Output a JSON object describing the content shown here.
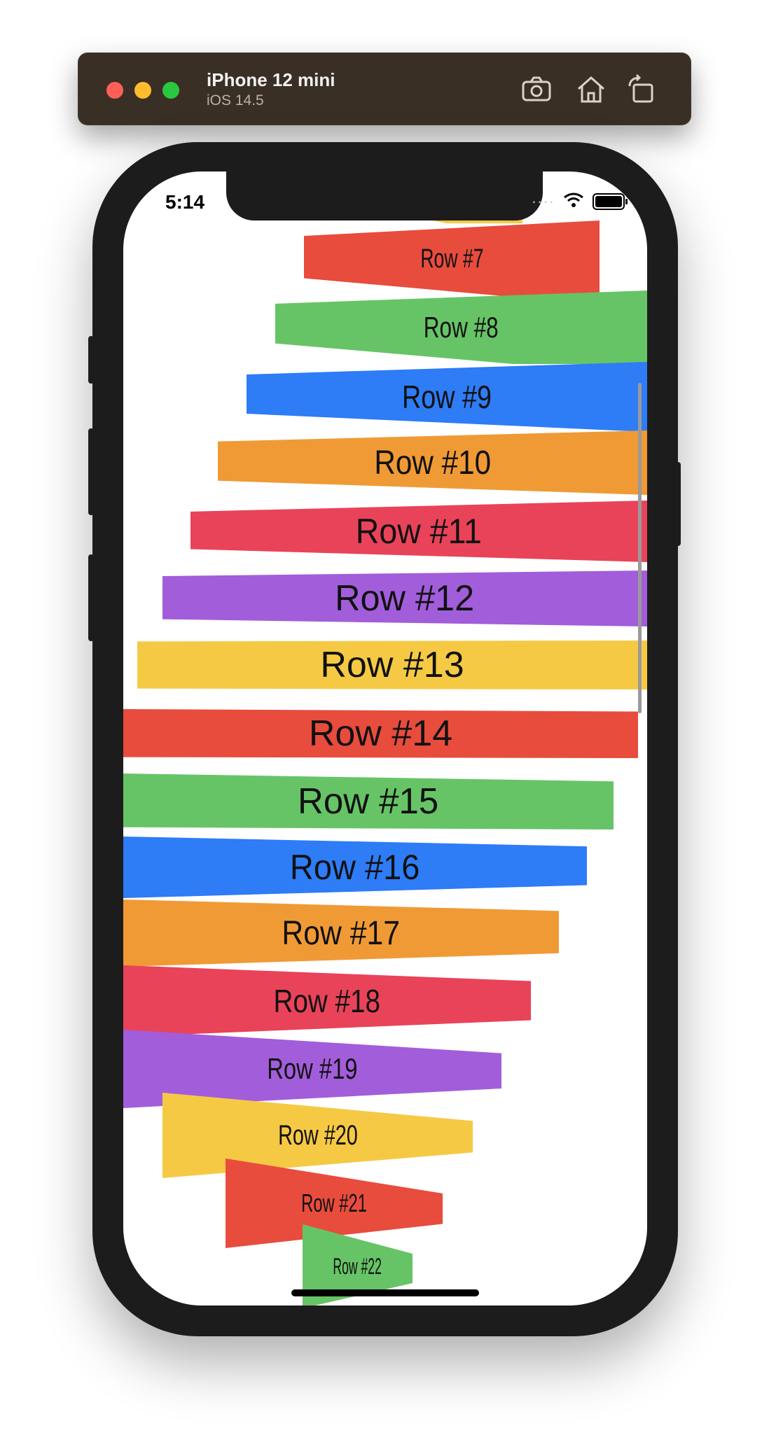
{
  "simulator": {
    "device_name": "iPhone 12 mini",
    "os_version": "iOS 14.5",
    "toolbar_icons": [
      "screenshot-icon",
      "home-icon",
      "rotate-icon"
    ]
  },
  "status_bar": {
    "time": "5:14",
    "icons": [
      "signal-icon",
      "wifi-icon",
      "battery-icon"
    ]
  },
  "rows": [
    {
      "label": "Row #7",
      "color": "#e84c3d"
    },
    {
      "label": "Row #8",
      "color": "#66c466"
    },
    {
      "label": "Row #9",
      "color": "#2e7cf6"
    },
    {
      "label": "Row #10",
      "color": "#f09a36"
    },
    {
      "label": "Row #11",
      "color": "#e9435a"
    },
    {
      "label": "Row #12",
      "color": "#a25ddb"
    },
    {
      "label": "Row #13",
      "color": "#f6c945"
    },
    {
      "label": "Row #14",
      "color": "#e84c3d"
    },
    {
      "label": "Row #15",
      "color": "#66c466"
    },
    {
      "label": "Row #16",
      "color": "#2e7cf6"
    },
    {
      "label": "Row #17",
      "color": "#f09a36"
    },
    {
      "label": "Row #18",
      "color": "#e9435a"
    },
    {
      "label": "Row #19",
      "color": "#a25ddb"
    },
    {
      "label": "Row #20",
      "color": "#f6c945"
    },
    {
      "label": "Row #21",
      "color": "#e84c3d"
    },
    {
      "label": "Row #22",
      "color": "#66c466"
    }
  ]
}
